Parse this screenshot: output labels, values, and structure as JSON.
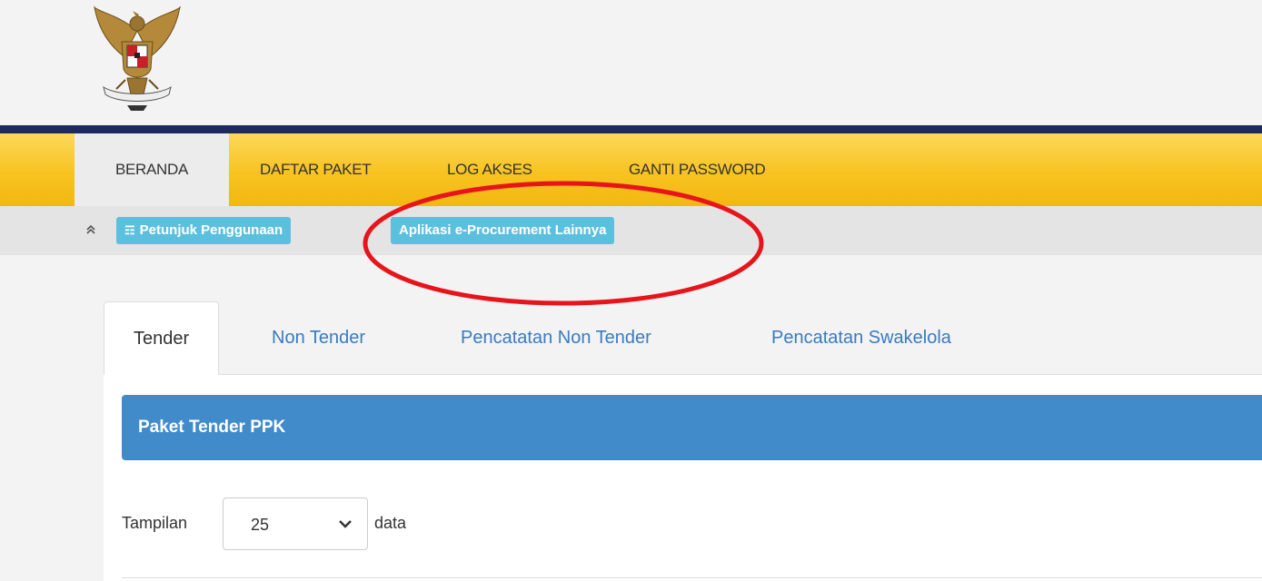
{
  "header": {
    "logo_icon": "garuda-emblem-icon"
  },
  "nav": {
    "items": [
      {
        "label": "BERANDA",
        "active": true
      },
      {
        "label": "DAFTAR PAKET",
        "active": false
      },
      {
        "label": "LOG AKSES",
        "active": false
      },
      {
        "label": "GANTI PASSWORD",
        "active": false
      }
    ]
  },
  "subbar": {
    "toggle_icon": "double-chevron-up-icon",
    "guide_icon": "book-icon",
    "guide_label": "Petunjuk Penggunaan",
    "other_apps_label": "Aplikasi e-Procurement Lainnya",
    "chip_color": "#5bc0de"
  },
  "annotation": {
    "shape": "red-ellipse",
    "color": "#e8141b"
  },
  "tabs": [
    {
      "label": "Tender",
      "active": true
    },
    {
      "label": "Non Tender",
      "active": false
    },
    {
      "label": "Pencatatan Non Tender",
      "active": false
    },
    {
      "label": "Pencatatan Swakelola",
      "active": false
    }
  ],
  "panel": {
    "heading": "Paket Tender PPK",
    "heading_color": "#428bca",
    "length_prefix": "Tampilan",
    "length_value": "25",
    "length_suffix": "data"
  },
  "colors": {
    "navbar": "#f8c320",
    "stripe": "#1e2a5e",
    "link": "#3a7bc0"
  }
}
